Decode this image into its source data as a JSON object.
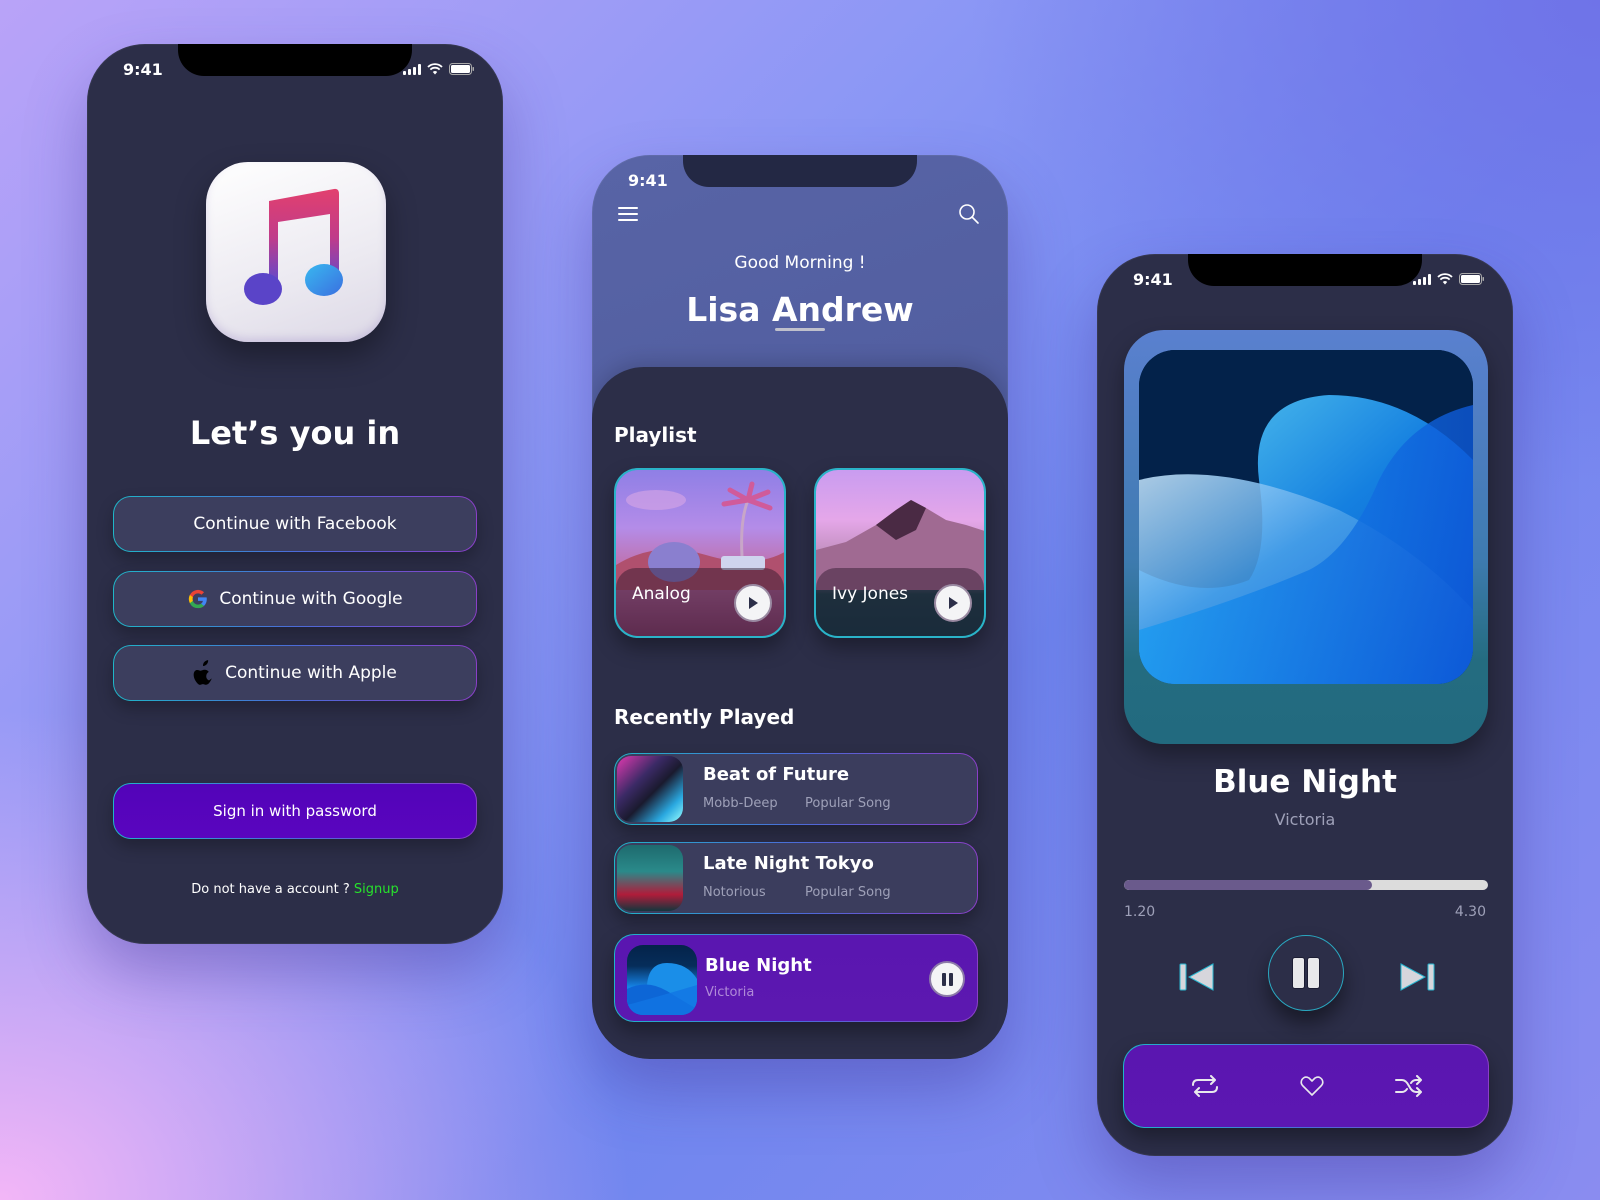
{
  "status_bar": {
    "time": "9:41"
  },
  "login": {
    "title": "Let’s you in",
    "buttons": [
      {
        "label": "Continue with Facebook",
        "icon": "none"
      },
      {
        "label": "Continue with Google",
        "icon": "google-icon"
      },
      {
        "label": "Continue with Apple",
        "icon": "apple-icon"
      }
    ],
    "primary_button": "Sign in with password",
    "signup_prompt": "Do not have a account ?",
    "signup_link": "Signup",
    "colors": {
      "primary": "#5204b8",
      "link": "#27e22c",
      "background": "#2c2e48"
    }
  },
  "home": {
    "greeting": "Good Morning !",
    "user_name": "Lisa Andrew",
    "playlist_title": "Playlist",
    "playlists": [
      {
        "label": "Analog"
      },
      {
        "label": "Ivy Jones"
      }
    ],
    "recent_title": "Recently Played",
    "recent": [
      {
        "title": "Beat of Future",
        "artist": "Mobb-Deep",
        "tag": "Popular Song"
      },
      {
        "title": "Late Night Tokyo",
        "artist": "Notorious",
        "tag": "Popular Song"
      }
    ],
    "now_playing": {
      "title": "Blue Night",
      "artist": "Victoria",
      "state": "playing"
    }
  },
  "player": {
    "title": "Blue Night",
    "artist": "Victoria",
    "current_time": "1.20",
    "total_time": "4.30",
    "progress_fraction": 0.68,
    "actions": [
      "repeat-icon",
      "heart-icon",
      "shuffle-icon"
    ]
  }
}
